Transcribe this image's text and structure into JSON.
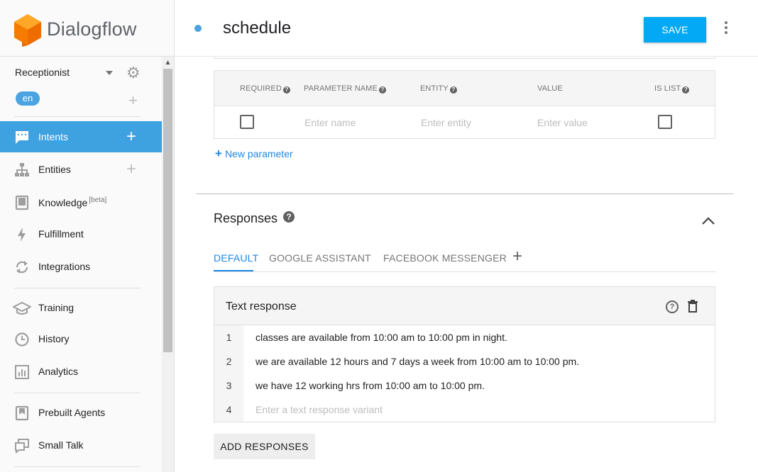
{
  "brand": {
    "name": "Dialogflow",
    "colors": {
      "accent": "#03a9f4",
      "active_nav": "#3ea1e0",
      "logo_orange": "#f57c00"
    }
  },
  "sidebar": {
    "agent_name": "Receptionist",
    "language": "en",
    "items": [
      {
        "label": "Intents",
        "icon": "chat-icon",
        "active": true,
        "has_add": true
      },
      {
        "label": "Entities",
        "icon": "hierarchy-icon",
        "has_add": true
      },
      {
        "label": "Knowledge",
        "badge": "[beta]",
        "icon": "book-icon"
      },
      {
        "label": "Fulfillment",
        "icon": "bolt-icon"
      },
      {
        "label": "Integrations",
        "icon": "sync-icon"
      },
      {
        "label": "Training",
        "icon": "graduation-cap-icon"
      },
      {
        "label": "History",
        "icon": "clock-icon"
      },
      {
        "label": "Analytics",
        "icon": "bar-chart-icon"
      },
      {
        "label": "Prebuilt Agents",
        "icon": "bookmark-book-icon"
      },
      {
        "label": "Small Talk",
        "icon": "chat-bubbles-icon"
      }
    ]
  },
  "header": {
    "intent_name": "schedule",
    "save_label": "SAVE"
  },
  "parameters": {
    "columns": {
      "required": "REQUIRED",
      "name": "PARAMETER NAME",
      "entity": "ENTITY",
      "value": "VALUE",
      "is_list": "IS LIST"
    },
    "row": {
      "name_placeholder": "Enter name",
      "entity_placeholder": "Enter entity",
      "value_placeholder": "Enter value",
      "required_checked": false,
      "is_list_checked": false
    },
    "new_parameter_label": "New parameter"
  },
  "responses": {
    "title": "Responses",
    "tabs": [
      "DEFAULT",
      "GOOGLE ASSISTANT",
      "FACEBOOK MESSENGER"
    ],
    "active_tab": "DEFAULT",
    "card_title": "Text response",
    "lines": [
      {
        "num": "1",
        "text": "classes are available from 10:00 am to 10:00 pm in night."
      },
      {
        "num": "2",
        "text": "we are available 12 hours and 7 days a week from 10:00 am to  10:00 pm."
      },
      {
        "num": "3",
        "text": "we have 12 working hrs from 10:00 am to  10:00 pm."
      },
      {
        "num": "4",
        "placeholder": "Enter a text response variant"
      }
    ],
    "add_button": "ADD RESPONSES"
  }
}
